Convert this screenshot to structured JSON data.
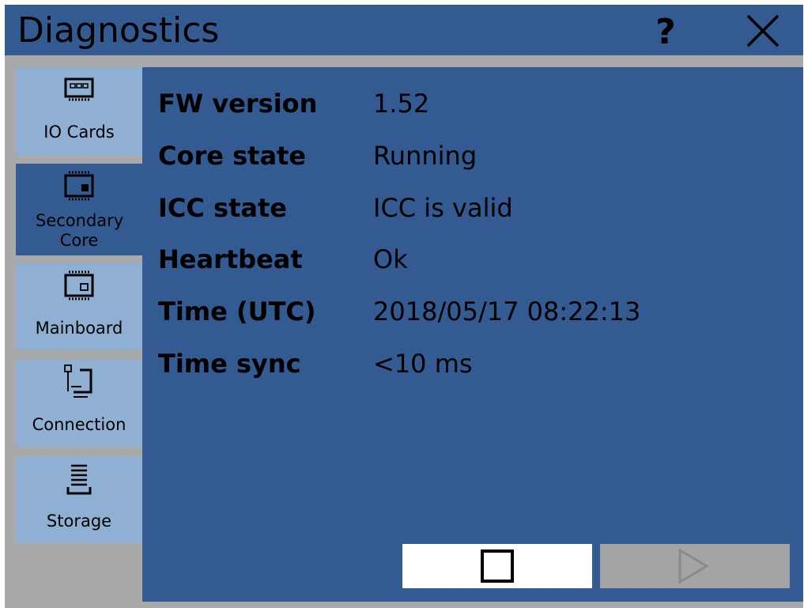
{
  "window": {
    "title": "Diagnostics",
    "help_label": "?",
    "close_icon": "close-icon"
  },
  "sidebar": {
    "items": [
      {
        "label": "IO Cards",
        "icon": "io-cards-icon",
        "active": false
      },
      {
        "label": "Secondary Core",
        "icon": "secondary-core-icon",
        "active": true
      },
      {
        "label": "Mainboard",
        "icon": "mainboard-icon",
        "active": false
      },
      {
        "label": "Connection",
        "icon": "connection-icon",
        "active": false
      },
      {
        "label": "Storage",
        "icon": "storage-icon",
        "active": false
      }
    ]
  },
  "details": {
    "rows": [
      {
        "key": "FW version",
        "value": "1.52"
      },
      {
        "key": "Core state",
        "value": "Running"
      },
      {
        "key": "ICC state",
        "value": "ICC is valid"
      },
      {
        "key": "Heartbeat",
        "value": "Ok"
      },
      {
        "key": "Time (UTC)",
        "value": "2018/05/17 08:22:13"
      },
      {
        "key": "Time sync",
        "value": "<10 ms"
      }
    ]
  },
  "actions": {
    "stop_icon": "stop-icon",
    "play_icon": "play-icon",
    "play_enabled": false
  },
  "colors": {
    "panel_blue": "#335b91",
    "sidebar_light": "#8fb0d3",
    "frame_gray": "#a9a9a9",
    "disabled_gray": "#a4a4a4"
  }
}
